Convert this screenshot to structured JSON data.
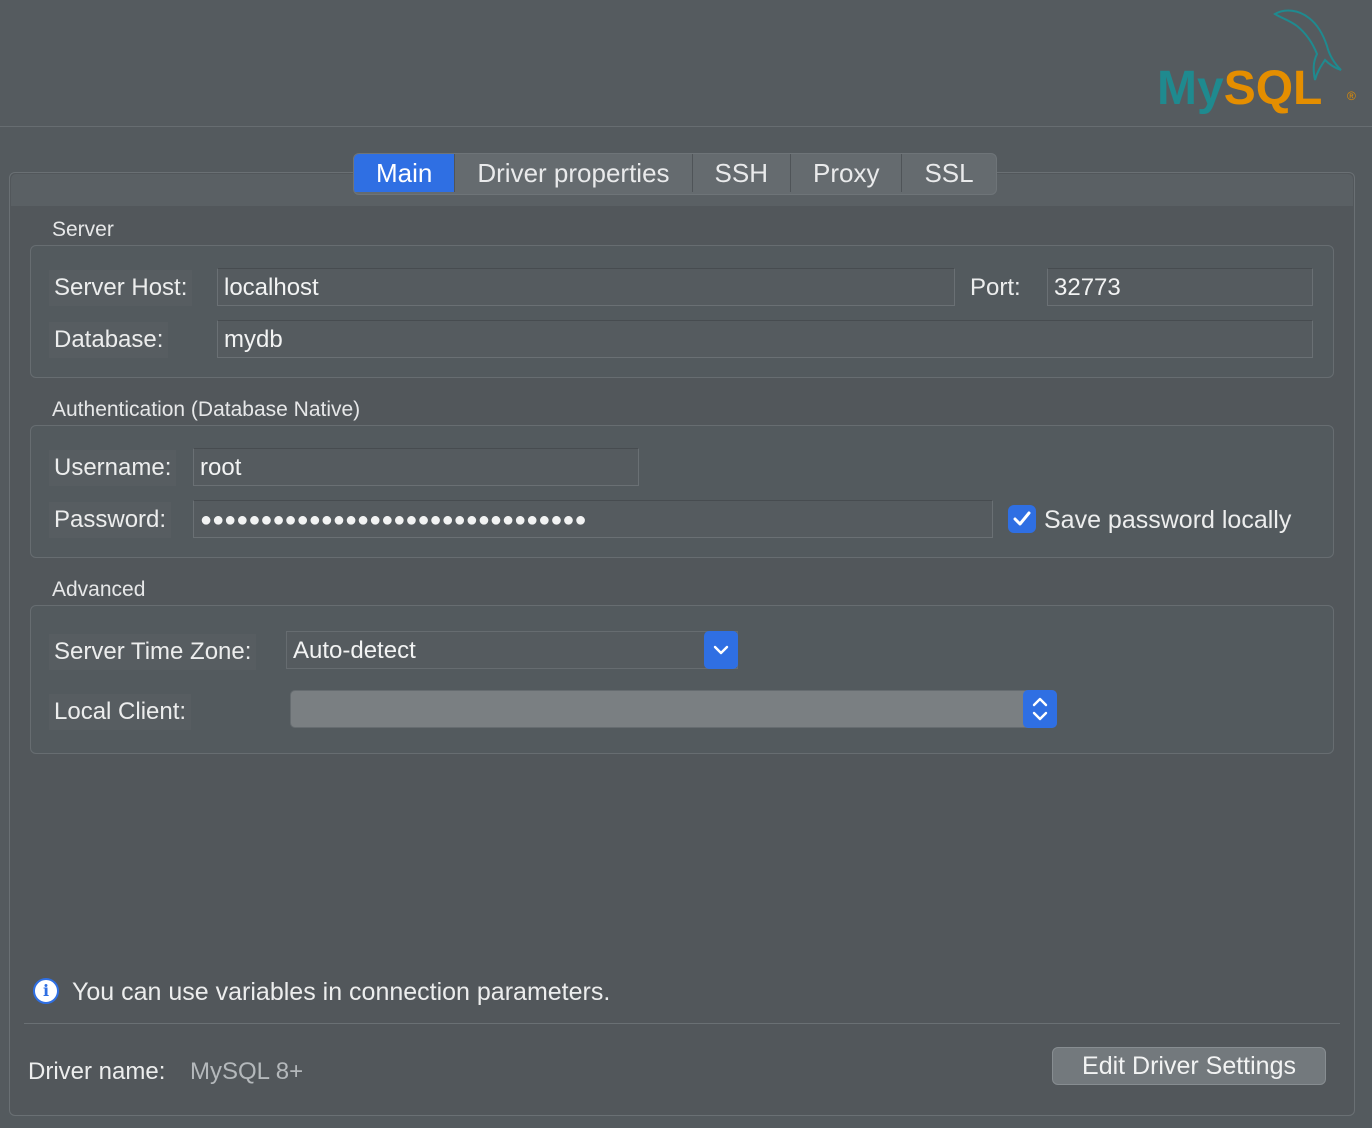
{
  "logo": {
    "text": "MySQL",
    "registered": "®"
  },
  "tabs": [
    {
      "label": "Main",
      "active": true
    },
    {
      "label": "Driver properties",
      "active": false
    },
    {
      "label": "SSH",
      "active": false
    },
    {
      "label": "Proxy",
      "active": false
    },
    {
      "label": "SSL",
      "active": false
    }
  ],
  "server": {
    "title": "Server",
    "host_label": "Server Host:",
    "host_value": "localhost",
    "port_label": "Port:",
    "port_value": "32773",
    "database_label": "Database:",
    "database_value": "mydb"
  },
  "auth": {
    "title": "Authentication (Database Native)",
    "username_label": "Username:",
    "username_value": "root",
    "password_label": "Password:",
    "password_mask": "●●●●●●●●●●●●●●●●●●●●●●●●●●●●●●●●",
    "save_password_label": "Save password locally",
    "save_password_checked": true
  },
  "advanced": {
    "title": "Advanced",
    "timezone_label": "Server Time Zone:",
    "timezone_value": "Auto-detect",
    "local_client_label": "Local Client:",
    "local_client_value": ""
  },
  "info": {
    "text": "You can use variables in connection parameters."
  },
  "footer": {
    "driver_label": "Driver name:",
    "driver_value": "MySQL 8+",
    "edit_button": "Edit Driver Settings"
  },
  "colors": {
    "accent": "#2f6fe3",
    "logo_teal": "#1f8a8f",
    "logo_orange": "#e48e00"
  }
}
